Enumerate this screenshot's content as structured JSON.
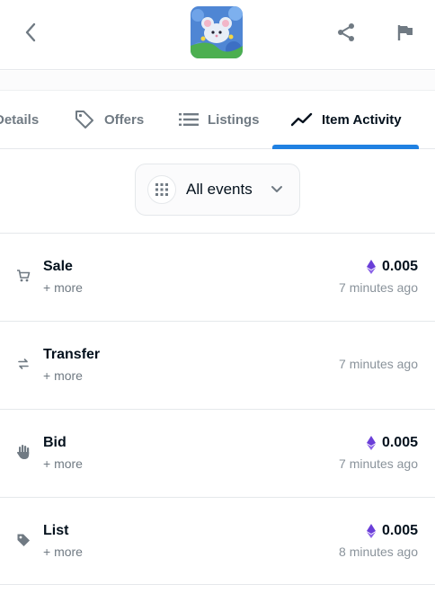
{
  "header": {
    "back_icon": "chevron-left-icon",
    "thumbnail_icon": "nft-thumbnail-mouse",
    "share_icon": "share-icon",
    "flag_icon": "flag-icon"
  },
  "tabs": [
    {
      "label": "Details",
      "icon": "details-icon",
      "active": false
    },
    {
      "label": "Offers",
      "icon": "tag-icon",
      "active": false
    },
    {
      "label": "Listings",
      "icon": "list-icon",
      "active": false
    },
    {
      "label": "Item Activity",
      "icon": "activity-chart-icon",
      "active": true
    }
  ],
  "filter": {
    "label": "All events",
    "icon": "grid-icon",
    "chevron": "chevron-down-icon"
  },
  "events": [
    {
      "name": "Sale",
      "more": "+ more",
      "price": "0.005",
      "time": "7 minutes ago",
      "icon": "cart-icon"
    },
    {
      "name": "Transfer",
      "more": "+ more",
      "price": "",
      "time": "7 minutes ago",
      "icon": "transfer-icon"
    },
    {
      "name": "Bid",
      "more": "+ more",
      "price": "0.005",
      "time": "7 minutes ago",
      "icon": "hand-icon"
    },
    {
      "name": "List",
      "more": "+ more",
      "price": "0.005",
      "time": "8 minutes ago",
      "icon": "tag-icon"
    }
  ],
  "colors": {
    "accent": "#2081e2",
    "eth": "#6a3ed8",
    "muted": "#707a83"
  }
}
